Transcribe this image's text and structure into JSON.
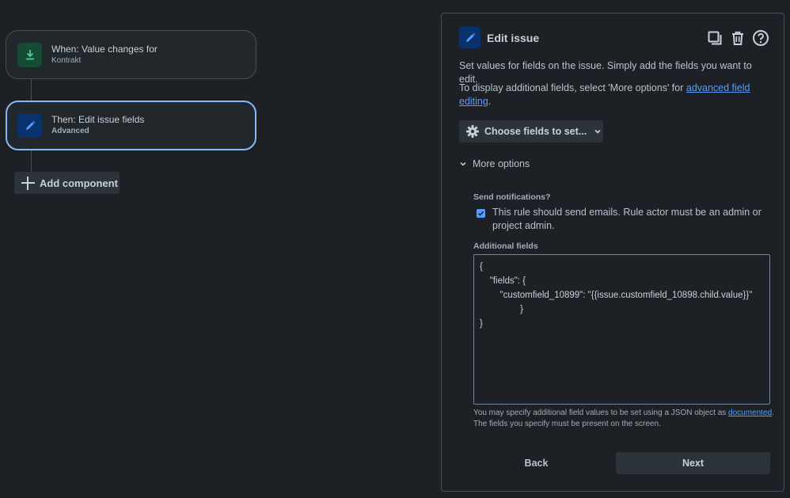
{
  "flow": {
    "trigger": {
      "title": "When: Value changes for",
      "subtitle": "Kontrakt",
      "icon": "download-arrow-icon"
    },
    "action": {
      "title": "Then: Edit issue fields",
      "subtitle": "Advanced",
      "icon": "pencil-icon"
    },
    "add_component_label": "Add component"
  },
  "panel": {
    "title": "Edit issue",
    "actions": [
      "copy-icon",
      "trash-icon",
      "help-icon"
    ],
    "description": "Set values for fields on the issue. Simply add the fields you want to edit.",
    "additional_prefix": "To display additional fields, select 'More options' for ",
    "additional_link": "advanced field editing",
    "additional_suffix": ".",
    "choose_fields_label": "Choose fields to set...",
    "more_options_label": "More options",
    "send_notifications_label": "Send notifications?",
    "send_notifications_checked": true,
    "send_notifications_text": "This rule should send emails. Rule actor must be an admin or project admin.",
    "additional_fields_label": "Additional fields",
    "json_lines": [
      "{",
      "    \"fields\": {",
      "        \"customfield_10899\": \"{{issue.customfield_10898.child.value}}\"",
      "                }",
      "}"
    ],
    "help_prefix": "You may specify additional field values to be set using a JSON object as ",
    "help_link": "documented",
    "help_suffix": ". The fields you specify must be present on the screen.",
    "back_label": "Back",
    "next_label": "Next"
  },
  "colors": {
    "background": "#1d2125",
    "accent": "#579dff",
    "selected_border": "#85b8ff",
    "trigger_icon_bg": "#164b35",
    "action_icon_bg": "#09326c"
  }
}
